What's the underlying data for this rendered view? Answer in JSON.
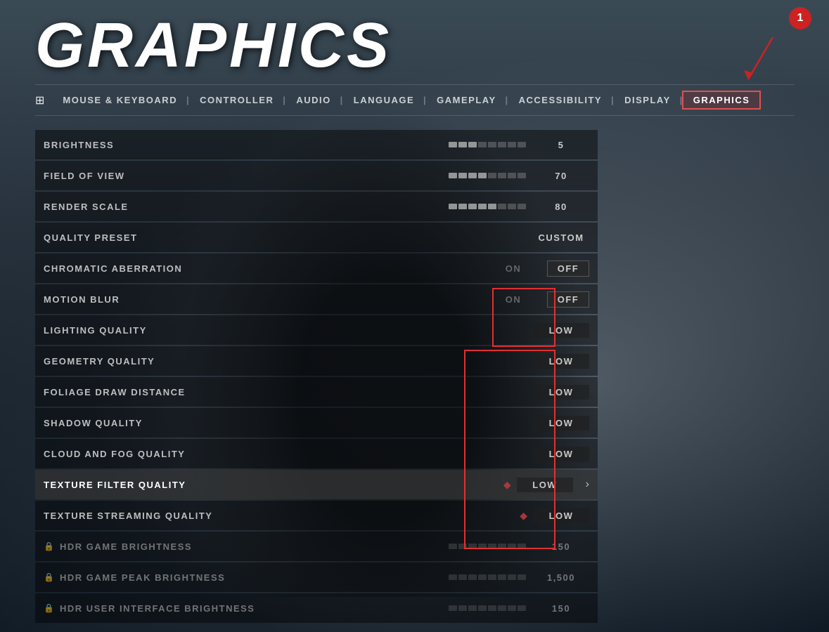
{
  "page": {
    "title": "GRAPHICS",
    "background_color": "#2a3540"
  },
  "nav": {
    "icon": "⊞",
    "tabs": [
      {
        "label": "MOUSE & KEYBOARD",
        "active": false
      },
      {
        "label": "CONTROLLER",
        "active": false
      },
      {
        "label": "AUDIO",
        "active": false
      },
      {
        "label": "LANGUAGE",
        "active": false
      },
      {
        "label": "GAMEPLAY",
        "active": false
      },
      {
        "label": "ACCESSIBILITY",
        "active": false
      },
      {
        "label": "DISPLAY",
        "active": false
      },
      {
        "label": "GRAPHICS",
        "active": true
      }
    ]
  },
  "annotation": {
    "number": "1"
  },
  "settings": [
    {
      "label": "BRIGHTNESS",
      "value": "5",
      "type": "slider",
      "locked": false,
      "active": false
    },
    {
      "label": "FIELD OF VIEW",
      "value": "70",
      "type": "slider",
      "locked": false,
      "active": false
    },
    {
      "label": "RENDER SCALE",
      "value": "80",
      "type": "slider",
      "locked": false,
      "active": false
    },
    {
      "label": "QUALITY PRESET",
      "value": "CUSTOM",
      "type": "select",
      "locked": false,
      "active": false
    },
    {
      "label": "CHROMATIC ABERRATION",
      "value_left": "ON",
      "value_right": "OFF",
      "type": "toggle",
      "locked": false,
      "active": false,
      "highlighted_off": true
    },
    {
      "label": "MOTION BLUR",
      "value_left": "ON",
      "value_right": "OFF",
      "type": "toggle",
      "locked": false,
      "active": false,
      "highlighted_off": true
    },
    {
      "label": "LIGHTING QUALITY",
      "value": "LOW",
      "type": "select",
      "locked": false,
      "active": false
    },
    {
      "label": "GEOMETRY QUALITY",
      "value": "LOW",
      "type": "select",
      "locked": false,
      "active": false
    },
    {
      "label": "FOLIAGE DRAW DISTANCE",
      "value": "LOW",
      "type": "select",
      "locked": false,
      "active": false
    },
    {
      "label": "SHADOW QUALITY",
      "value": "LOW",
      "type": "select",
      "locked": false,
      "active": false
    },
    {
      "label": "CLOUD AND FOG QUALITY",
      "value": "LOW",
      "type": "select",
      "locked": false,
      "active": false
    },
    {
      "label": "TEXTURE FILTER QUALITY",
      "value": "LOW",
      "type": "select",
      "locked": false,
      "active": true,
      "has_arrow": true
    },
    {
      "label": "TEXTURE STREAMING QUALITY",
      "value": "LOW",
      "type": "select",
      "locked": false,
      "active": false
    },
    {
      "label": "HDR GAME BRIGHTNESS",
      "value": "150",
      "type": "slider",
      "locked": true,
      "active": false
    },
    {
      "label": "HDR GAME PEAK BRIGHTNESS",
      "value": "1,500",
      "type": "slider",
      "locked": true,
      "active": false
    },
    {
      "label": "HDR USER INTERFACE BRIGHTNESS",
      "value": "150",
      "type": "slider",
      "locked": true,
      "active": false
    }
  ],
  "icons": {
    "lock": "🔒",
    "arrow_right": "›",
    "controller_icon": "⊞"
  }
}
